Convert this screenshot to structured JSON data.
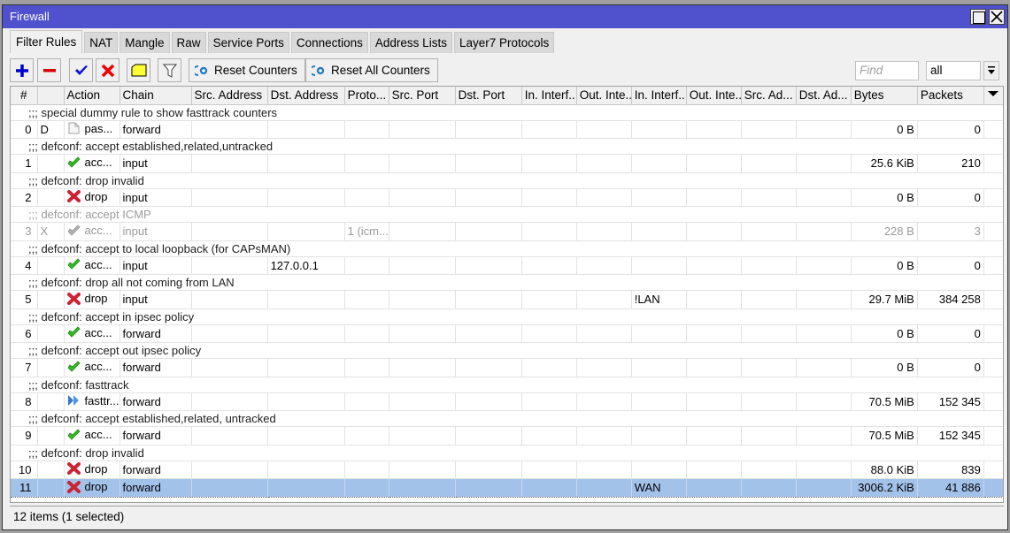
{
  "window": {
    "title": "Firewall",
    "maximize_icon": "maximize-icon",
    "close_icon": "close-icon"
  },
  "tabs": [
    {
      "label": "Filter Rules",
      "active": true
    },
    {
      "label": "NAT"
    },
    {
      "label": "Mangle"
    },
    {
      "label": "Raw"
    },
    {
      "label": "Service Ports"
    },
    {
      "label": "Connections"
    },
    {
      "label": "Address Lists"
    },
    {
      "label": "Layer7 Protocols"
    }
  ],
  "toolbar": {
    "add_icon": "plus-icon",
    "remove_icon": "minus-icon",
    "enable_icon": "check-icon",
    "disable_icon": "x-icon",
    "comment_icon": "note-icon",
    "filter_icon": "funnel-icon",
    "reset_counters_label": "Reset Counters",
    "reset_all_counters_label": "Reset All Counters",
    "find_placeholder": "Find",
    "filter_select_value": "all",
    "accent_colors": {
      "add": "#0000cc",
      "remove": "#dd0000",
      "enable": "#0000ee",
      "disable": "#ee0000",
      "comment": "#ffff33"
    }
  },
  "table": {
    "columns": [
      "#",
      "",
      "Action",
      "Chain",
      "Src. Address",
      "Dst. Address",
      "Proto...",
      "Src. Port",
      "Dst. Port",
      "In. Interf...",
      "Out. Inte...",
      "In. Interf...",
      "Out. Inte...",
      "Src. Ad...",
      "Dst. Ad...",
      "Bytes",
      "Packets"
    ],
    "rows": [
      {
        "comment": ";;; special dummy rule to show fasttrack counters",
        "index": "0",
        "flag": "D",
        "action_icon": "passthrough",
        "action": "pas...",
        "chain": "forward",
        "dst_address": "",
        "protocol": "",
        "in_interface_list": "",
        "bytes": "0 B",
        "packets": "0"
      },
      {
        "comment": ";;; defconf: accept established,related,untracked",
        "index": "1",
        "flag": "",
        "action_icon": "accept",
        "action": "acc...",
        "chain": "input",
        "dst_address": "",
        "protocol": "",
        "in_interface_list": "",
        "bytes": "25.6 KiB",
        "packets": "210"
      },
      {
        "comment": ";;; defconf: drop invalid",
        "index": "2",
        "flag": "",
        "action_icon": "drop",
        "action": "drop",
        "chain": "input",
        "dst_address": "",
        "protocol": "",
        "in_interface_list": "",
        "bytes": "0 B",
        "packets": "0"
      },
      {
        "comment": ";;; defconf: accept ICMP",
        "index": "3",
        "flag": "X",
        "disabled": true,
        "action_icon": "accept-disabled",
        "action": "acc...",
        "chain": "input",
        "dst_address": "",
        "protocol": "1 (icm...",
        "in_interface_list": "",
        "bytes": "228 B",
        "packets": "3"
      },
      {
        "comment": ";;; defconf: accept to local loopback (for CAPsMAN)",
        "index": "4",
        "flag": "",
        "action_icon": "accept",
        "action": "acc...",
        "chain": "input",
        "dst_address": "127.0.0.1",
        "protocol": "",
        "in_interface_list": "",
        "bytes": "0 B",
        "packets": "0"
      },
      {
        "comment": ";;; defconf: drop all not coming from LAN",
        "index": "5",
        "flag": "",
        "action_icon": "drop",
        "action": "drop",
        "chain": "input",
        "dst_address": "",
        "protocol": "",
        "in_interface_list": "!LAN",
        "bytes": "29.7 MiB",
        "packets": "384 258"
      },
      {
        "comment": ";;; defconf: accept in ipsec policy",
        "index": "6",
        "flag": "",
        "action_icon": "accept",
        "action": "acc...",
        "chain": "forward",
        "dst_address": "",
        "protocol": "",
        "in_interface_list": "",
        "bytes": "0 B",
        "packets": "0"
      },
      {
        "comment": ";;; defconf: accept out ipsec policy",
        "index": "7",
        "flag": "",
        "action_icon": "accept",
        "action": "acc...",
        "chain": "forward",
        "dst_address": "",
        "protocol": "",
        "in_interface_list": "",
        "bytes": "0 B",
        "packets": "0"
      },
      {
        "comment": ";;; defconf: fasttrack",
        "index": "8",
        "flag": "",
        "action_icon": "fasttrack",
        "action": "fasttr...",
        "chain": "forward",
        "dst_address": "",
        "protocol": "",
        "in_interface_list": "",
        "bytes": "70.5 MiB",
        "packets": "152 345"
      },
      {
        "comment": ";;; defconf: accept established,related, untracked",
        "index": "9",
        "flag": "",
        "action_icon": "accept",
        "action": "acc...",
        "chain": "forward",
        "dst_address": "",
        "protocol": "",
        "in_interface_list": "",
        "bytes": "70.5 MiB",
        "packets": "152 345"
      },
      {
        "comment": ";;; defconf: drop invalid",
        "index": "10",
        "flag": "",
        "action_icon": "drop",
        "action": "drop",
        "chain": "forward",
        "dst_address": "",
        "protocol": "",
        "in_interface_list": "",
        "bytes": "88.0 KiB",
        "packets": "839"
      },
      {
        "comment": null,
        "index": "11",
        "flag": "",
        "selected": true,
        "action_icon": "drop",
        "action": "drop",
        "chain": "forward",
        "dst_address": "",
        "protocol": "",
        "in_interface_list": "WAN",
        "bytes": "3006.2 KiB",
        "packets": "41 886"
      }
    ]
  },
  "status": {
    "text": "12 items (1 selected)"
  },
  "colors": {
    "titlebar": "#4f52cc",
    "selected_row": "#a3c2ea",
    "accept": "#33bb22",
    "drop": "#cc2233",
    "fasttrack": "#3377cc"
  }
}
